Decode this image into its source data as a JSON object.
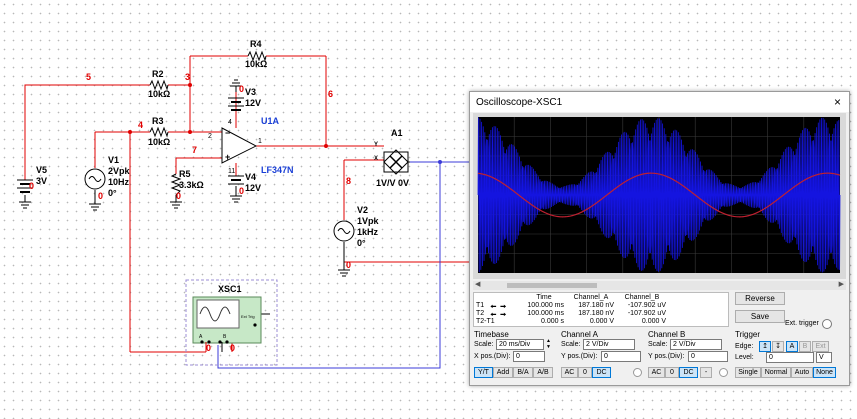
{
  "schematic": {
    "nets": [
      "5",
      "3",
      "6",
      "4",
      "7",
      "8"
    ],
    "components": {
      "r4": {
        "ref": "R4",
        "value": "10kΩ"
      },
      "r2": {
        "ref": "R2",
        "value": "10kΩ"
      },
      "r3": {
        "ref": "R3",
        "value": "10kΩ"
      },
      "r5": {
        "ref": "R5",
        "value": "3.3kΩ"
      },
      "v3": {
        "ref": "V3",
        "value": "12V"
      },
      "v4": {
        "ref": "V4",
        "value": "12V"
      },
      "u1a": {
        "ref": "U1A",
        "value": "LF347N"
      },
      "v5": {
        "ref": "V5",
        "value": "3V"
      },
      "v1": {
        "ref": "V1",
        "amp": "2Vpk",
        "freq": "10Hz",
        "phase": "0°"
      },
      "v2": {
        "ref": "V2",
        "amp": "1Vpk",
        "freq": "1kHz",
        "phase": "0°"
      },
      "a1": {
        "ref": "A1",
        "value": "1V/V 0V",
        "pin_y": "Y",
        "pin_x": "X"
      },
      "xsc1": {
        "ref": "XSC1",
        "pin_a": "A",
        "pin_b": "B",
        "pin_ext": "Ext Trig"
      }
    },
    "pins": {
      "plus": "+",
      "minus": "−",
      "one": "1",
      "two": "2",
      "four": "4",
      "eleven": "11",
      "zero": "0"
    }
  },
  "oscilloscope": {
    "title": "Oscilloscope-XSC1",
    "close_icon": "×",
    "trace_colors": {
      "channel_a": "#c02030",
      "channel_b": "#1414e0",
      "screen": "#000000",
      "grid": "#3a3a3a"
    },
    "cursors": {
      "headers": [
        "Time",
        "Channel_A",
        "Channel_B"
      ],
      "rows": [
        {
          "label": "T1",
          "time": "100.000 ms",
          "a": "187.180 nV",
          "b": "-107.902 uV"
        },
        {
          "label": "T2",
          "time": "100.000 ms",
          "a": "187.180 nV",
          "b": "-107.902 uV"
        },
        {
          "label": "T2-T1",
          "time": "0.000 s",
          "a": "0.000 V",
          "b": "0.000 V"
        }
      ]
    },
    "buttons": {
      "reverse": "Reverse",
      "save": "Save",
      "ext_trigger": "Ext. trigger"
    },
    "timebase": {
      "title": "Timebase",
      "scale_label": "Scale:",
      "scale_value": "20 ms/Div",
      "xpos_label": "X pos.(Div):",
      "xpos_value": "0",
      "modes": [
        "Y/T",
        "Add",
        "B/A",
        "A/B"
      ],
      "active_mode": "Y/T"
    },
    "channel_a": {
      "title": "Channel A",
      "scale_label": "Scale:",
      "scale_value": "2  V/Div",
      "ypos_label": "Y pos.(Div):",
      "ypos_value": "0",
      "coupling": [
        "AC",
        "0",
        "DC"
      ],
      "active_coupling": "DC"
    },
    "channel_b": {
      "title": "Channel B",
      "scale_label": "Scale:",
      "scale_value": "2  V/Div",
      "ypos_label": "Y pos.(Div):",
      "ypos_value": "0",
      "coupling": [
        "AC",
        "0",
        "DC",
        "-"
      ],
      "active_coupling": "DC"
    },
    "trigger": {
      "title": "Trigger",
      "edge_label": "Edge:",
      "edges": [
        "rising",
        "falling",
        "A",
        "B",
        "Ext"
      ],
      "level_label": "Level:",
      "level_value": "0",
      "level_unit": "V",
      "modes": [
        "Single",
        "Normal",
        "Auto",
        "None"
      ],
      "active_mode": "None"
    }
  }
}
